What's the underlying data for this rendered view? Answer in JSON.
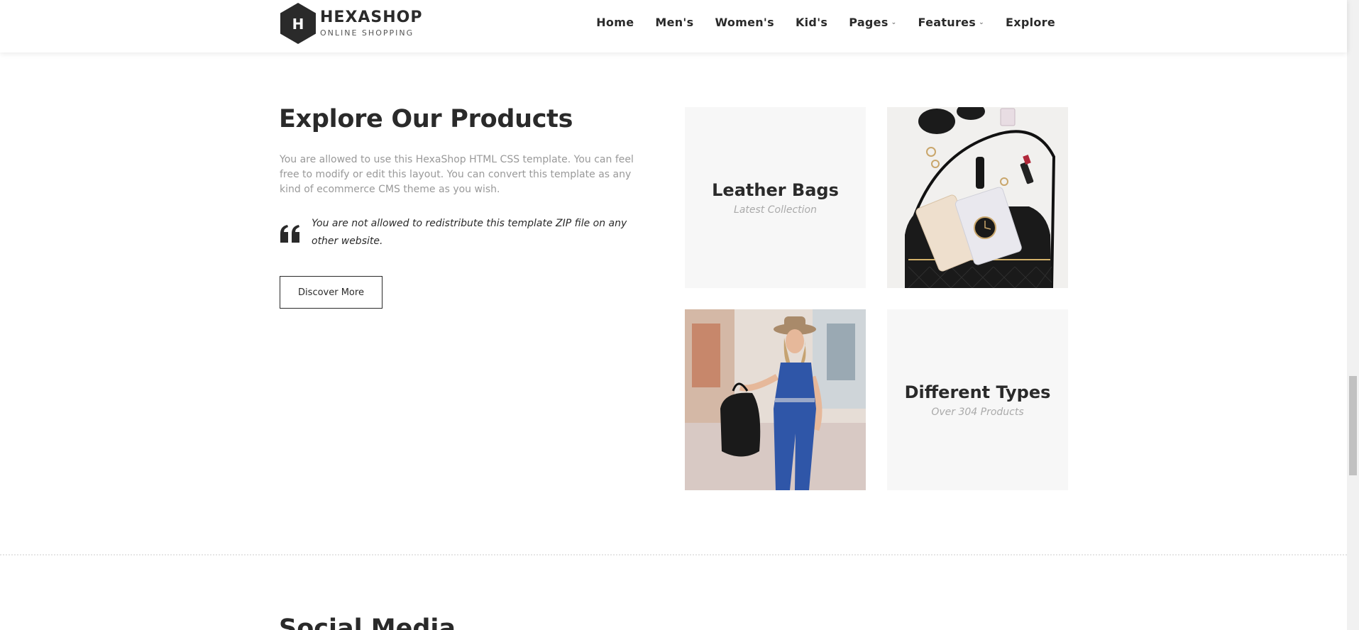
{
  "header": {
    "logo_letter": "H",
    "logo_title": "HEXASHOP",
    "logo_subtitle": "ONLINE SHOPPING",
    "nav": [
      {
        "label": "Home",
        "dropdown": false
      },
      {
        "label": "Men's",
        "dropdown": false
      },
      {
        "label": "Women's",
        "dropdown": false
      },
      {
        "label": "Kid's",
        "dropdown": false
      },
      {
        "label": "Pages",
        "dropdown": true
      },
      {
        "label": "Features",
        "dropdown": true
      },
      {
        "label": "Explore",
        "dropdown": false
      }
    ],
    "caret_icon": "chevron-down-icon"
  },
  "explore": {
    "title": "Explore Our Products",
    "description": "You are allowed to use this HexaShop HTML CSS template. You can feel free to modify or edit this layout. You can convert this template as any kind of ecommerce CMS theme as you wish.",
    "quote_icon": "quote-icon",
    "quote": "You are not allowed to redistribute this template ZIP file on any other website.",
    "button_label": "Discover More",
    "tiles": {
      "leather": {
        "title": "Leather Bags",
        "subtitle": "Latest Collection"
      },
      "types": {
        "title": "Different Types",
        "subtitle": "Over 304 Products"
      }
    },
    "images": {
      "bag_flatlay": "image-bag-accessories-flatlay",
      "woman": "image-woman-with-handbag"
    }
  },
  "next_section": {
    "title": "Social Media"
  },
  "colors": {
    "dark": "#2a2a2a",
    "muted": "#999999",
    "tile_bg": "#f7f7f7"
  }
}
